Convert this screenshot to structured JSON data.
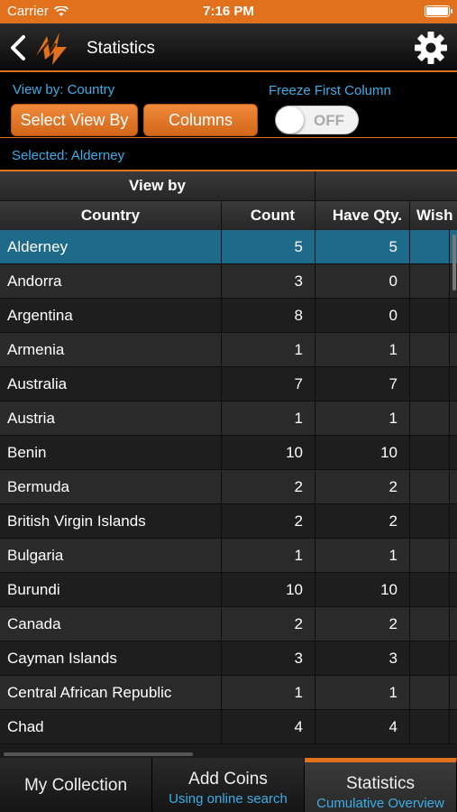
{
  "status": {
    "carrier": "Carrier",
    "time": "7:16 PM"
  },
  "nav": {
    "title": "Statistics"
  },
  "controls": {
    "view_by_label": "View by: Country",
    "freeze_label": "Freeze First Column",
    "select_view_by": "Select View By",
    "columns": "Columns",
    "toggle_state": "OFF",
    "selected_label": "Selected: Alderney"
  },
  "table": {
    "group_header": "View by",
    "headers": [
      "Country",
      "Count",
      "Have Qty.",
      "Wish"
    ],
    "rows": [
      {
        "country": "Alderney",
        "count": "5",
        "have": "5"
      },
      {
        "country": "Andorra",
        "count": "3",
        "have": "0"
      },
      {
        "country": "Argentina",
        "count": "8",
        "have": "0"
      },
      {
        "country": "Armenia",
        "count": "1",
        "have": "1"
      },
      {
        "country": "Australia",
        "count": "7",
        "have": "7"
      },
      {
        "country": "Austria",
        "count": "1",
        "have": "1"
      },
      {
        "country": "Benin",
        "count": "10",
        "have": "10"
      },
      {
        "country": "Bermuda",
        "count": "2",
        "have": "2"
      },
      {
        "country": "British Virgin Islands",
        "count": "2",
        "have": "2"
      },
      {
        "country": "Bulgaria",
        "count": "1",
        "have": "1"
      },
      {
        "country": "Burundi",
        "count": "10",
        "have": "10"
      },
      {
        "country": "Canada",
        "count": "2",
        "have": "2"
      },
      {
        "country": "Cayman Islands",
        "count": "3",
        "have": "3"
      },
      {
        "country": "Central African Republic",
        "count": "1",
        "have": "1"
      },
      {
        "country": "Chad",
        "count": "4",
        "have": "4"
      }
    ]
  },
  "tabs": [
    {
      "label": "My Collection",
      "sub": ""
    },
    {
      "label": "Add Coins",
      "sub": "Using online search"
    },
    {
      "label": "Statistics",
      "sub": "Cumulative Overview"
    }
  ],
  "colors": {
    "accent": "#e2711e",
    "link": "#3aaee8",
    "selected_row": "#1d6a8a"
  }
}
